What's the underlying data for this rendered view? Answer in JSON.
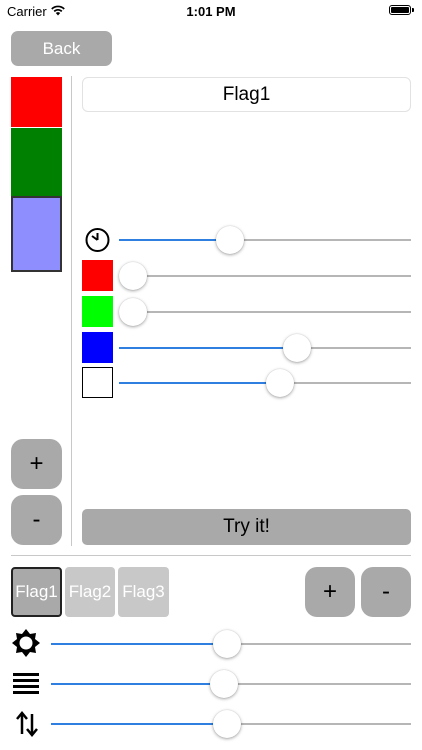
{
  "status_bar": {
    "carrier": "Carrier",
    "time": "1:01 PM",
    "wifi_icon": "wifi-icon",
    "battery_icon": "battery-icon"
  },
  "back_button": {
    "label": "Back"
  },
  "flag_editor": {
    "name": "Flag1",
    "swatches": [
      {
        "color": "#ff0000"
      },
      {
        "color": "#008000"
      },
      {
        "color": "#8e8eff",
        "selected": true
      }
    ],
    "add_label": "+",
    "remove_label": "-",
    "try_label": "Try it!",
    "sliders": [
      {
        "icon": "timer-icon",
        "value": 0.38
      },
      {
        "icon": "red-square",
        "color": "#ff0000",
        "value": 0.0
      },
      {
        "icon": "green-square",
        "color": "#00ff00",
        "value": 0.0
      },
      {
        "icon": "blue-square",
        "color": "#0000ff",
        "value": 0.61
      },
      {
        "icon": "white-square",
        "color": "#ffffff",
        "value": 0.55
      }
    ]
  },
  "flags_bar": {
    "tabs": [
      {
        "label": "Flag1",
        "selected": true
      },
      {
        "label": "Flag2",
        "selected": false
      },
      {
        "label": "Flag3",
        "selected": false
      }
    ],
    "add_label": "+",
    "remove_label": "-"
  },
  "global_sliders": [
    {
      "icon": "brightness-icon",
      "value": 0.49
    },
    {
      "icon": "lines-icon",
      "value": 0.48
    },
    {
      "icon": "vertical-arrows-icon",
      "value": 0.49
    }
  ],
  "colors": {
    "accent": "#2f7fe0",
    "button_gray": "#a9a9a9",
    "tab_gray": "#c8c8c8"
  }
}
